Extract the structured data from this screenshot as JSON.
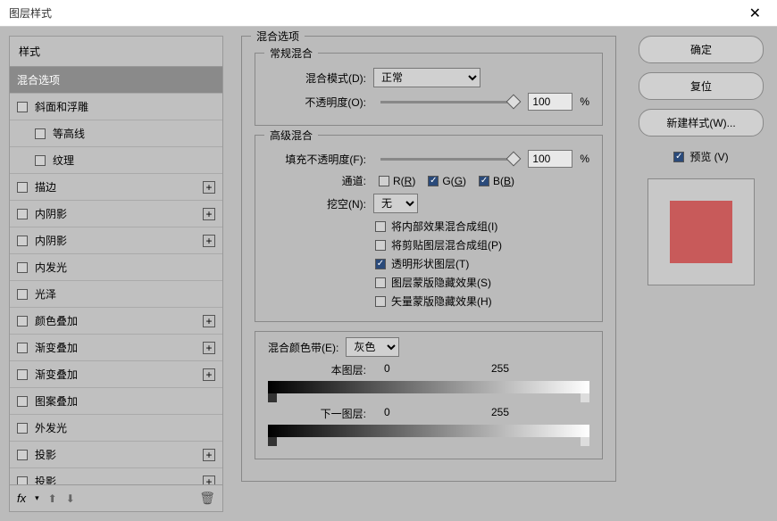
{
  "titlebar": {
    "title": "图层样式"
  },
  "left": {
    "header": "样式",
    "items": [
      {
        "label": "混合选项",
        "selected": true,
        "checkbox": false,
        "plus": false,
        "indent": false
      },
      {
        "label": "斜面和浮雕",
        "selected": false,
        "checkbox": true,
        "plus": false,
        "indent": false
      },
      {
        "label": "等高线",
        "selected": false,
        "checkbox": true,
        "plus": false,
        "indent": true
      },
      {
        "label": "纹理",
        "selected": false,
        "checkbox": true,
        "plus": false,
        "indent": true
      },
      {
        "label": "描边",
        "selected": false,
        "checkbox": true,
        "plus": true,
        "indent": false
      },
      {
        "label": "内阴影",
        "selected": false,
        "checkbox": true,
        "plus": true,
        "indent": false
      },
      {
        "label": "内阴影",
        "selected": false,
        "checkbox": true,
        "plus": true,
        "indent": false
      },
      {
        "label": "内发光",
        "selected": false,
        "checkbox": true,
        "plus": false,
        "indent": false
      },
      {
        "label": "光泽",
        "selected": false,
        "checkbox": true,
        "plus": false,
        "indent": false
      },
      {
        "label": "颜色叠加",
        "selected": false,
        "checkbox": true,
        "plus": true,
        "indent": false
      },
      {
        "label": "渐变叠加",
        "selected": false,
        "checkbox": true,
        "plus": true,
        "indent": false
      },
      {
        "label": "渐变叠加",
        "selected": false,
        "checkbox": true,
        "plus": true,
        "indent": false
      },
      {
        "label": "图案叠加",
        "selected": false,
        "checkbox": true,
        "plus": false,
        "indent": false
      },
      {
        "label": "外发光",
        "selected": false,
        "checkbox": true,
        "plus": false,
        "indent": false
      },
      {
        "label": "投影",
        "selected": false,
        "checkbox": true,
        "plus": true,
        "indent": false
      },
      {
        "label": "投影",
        "selected": false,
        "checkbox": true,
        "plus": true,
        "indent": false
      }
    ],
    "footer_fx": "fx"
  },
  "center": {
    "main_title": "混合选项",
    "general": {
      "title": "常规混合",
      "blend_mode_label": "混合模式(D):",
      "blend_mode_value": "正常",
      "opacity_label": "不透明度(O):",
      "opacity_value": "100",
      "pct": "%"
    },
    "advanced": {
      "title": "高级混合",
      "fill_label": "填充不透明度(F):",
      "fill_value": "100",
      "pct": "%",
      "channels_label": "通道:",
      "chan_r": "R(R)",
      "chan_g": "G(G)",
      "chan_b": "B(B)",
      "knockout_label": "挖空(N):",
      "knockout_value": "无",
      "opt1": "将内部效果混合成组(I)",
      "opt2": "将剪贴图层混合成组(P)",
      "opt3": "透明形状图层(T)",
      "opt4": "图层蒙版隐藏效果(S)",
      "opt5": "矢量蒙版隐藏效果(H)"
    },
    "blendif": {
      "label": "混合颜色带(E):",
      "value": "灰色",
      "this_layer": "本图层:",
      "underlying": "下一图层:",
      "v0": "0",
      "v255": "255"
    }
  },
  "right": {
    "ok": "确定",
    "reset": "复位",
    "new_style": "新建样式(W)...",
    "preview": "预览 (V)"
  }
}
